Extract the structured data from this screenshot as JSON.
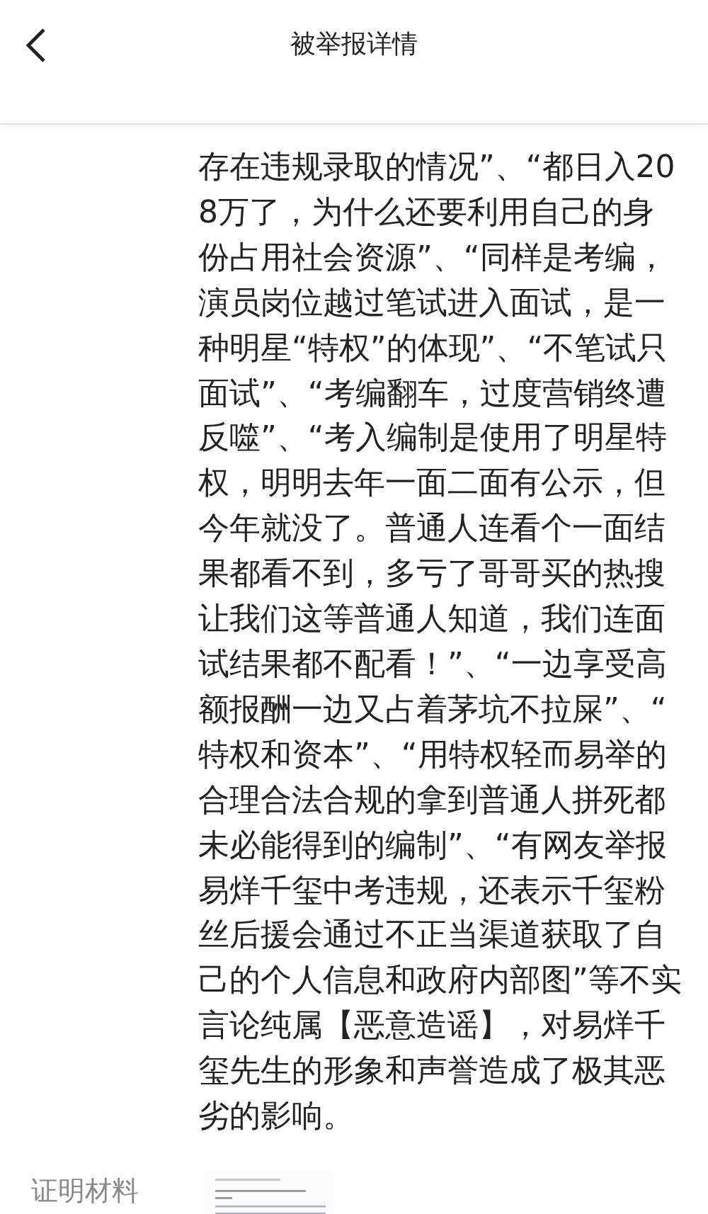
{
  "header": {
    "title": "被举报详情"
  },
  "report": {
    "text": "存在违规录取的情况”、“都日入208万了，为什么还要利用自己的身份占用社会资源”、“同样是考编，演员岗位越过笔试进入面试，是一种明星“特权”的体现”、“不笔试只面试”、“考编翻车，过度营销终遭反噬”、“考入编制是使用了明星特权，明明去年一面二面有公示，但今年就没了。普通人连看个一面结果都看不到，多亏了哥哥买的热搜让我们这等普通人知道，我们连面试结果都不配看！”、“一边享受高额报酬一边又占着茅坑不拉屎”、“特权和资本”、“用特权轻而易举的合理合法合规的拿到普通人拼死都未必能得到的编制”、“有网友举报易烊千玺中考违规，还表示千玺粉丝后援会通过不正当渠道获取了自己的个人信息和政府内部图”等不实言论纯属【恶意造谣】，对易烊千玺先生的形象和声誉造成了极其恶劣的影响。"
  },
  "evidence": {
    "label": "证明材料",
    "attachments": [
      {
        "kind": "document"
      }
    ]
  }
}
